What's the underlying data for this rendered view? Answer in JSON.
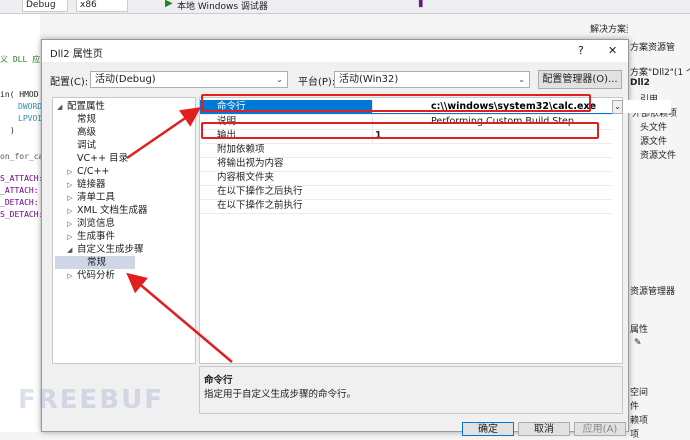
{
  "ide": {
    "config_combo": "Debug",
    "platform_combo": "x86",
    "run_label": "本地 Windows 调试器",
    "solution_explorer_title": "解决方案资源管理器",
    "code_lines": [
      "义 DLL 应",
      "in( HMOD",
      "DWORD",
      "LPVOI",
      ")",
      "on_for_ca",
      "S_ATTACH:",
      "_ATTACH:",
      "_DETACH:",
      "S_DETACH:"
    ],
    "right_items": [
      "方案资源管",
      "方案\"Dll2\"(1 个",
      "Dll2",
      "引用",
      "外部依赖项",
      "头文件",
      "源文件",
      "资源文件",
      "资源管理器",
      "属性",
      "空间",
      "件",
      "赖项",
      "项"
    ]
  },
  "dialog": {
    "title": "Dll2 属性页",
    "help_label": "?",
    "close_label": "✕",
    "config_label": "配置(C):",
    "config_value": "活动(Debug)",
    "platform_label": "平台(P):",
    "platform_value": "活动(Win32)",
    "config_manager_label": "配置管理器(O)...",
    "tree": [
      {
        "label": "配置属性",
        "twisty": "◢",
        "indent": 0
      },
      {
        "label": "常规",
        "twisty": "",
        "indent": 1
      },
      {
        "label": "高级",
        "twisty": "",
        "indent": 1
      },
      {
        "label": "调试",
        "twisty": "",
        "indent": 1
      },
      {
        "label": "VC++ 目录",
        "twisty": "",
        "indent": 1
      },
      {
        "label": "C/C++",
        "twisty": "▷",
        "indent": 1
      },
      {
        "label": "链接器",
        "twisty": "▷",
        "indent": 1
      },
      {
        "label": "清单工具",
        "twisty": "▷",
        "indent": 1
      },
      {
        "label": "XML 文档生成器",
        "twisty": "▷",
        "indent": 1
      },
      {
        "label": "浏览信息",
        "twisty": "▷",
        "indent": 1
      },
      {
        "label": "生成事件",
        "twisty": "▷",
        "indent": 1
      },
      {
        "label": "自定义生成步骤",
        "twisty": "◢",
        "indent": 1
      },
      {
        "label": "常规",
        "twisty": "",
        "indent": 2,
        "selected": true
      },
      {
        "label": "代码分析",
        "twisty": "▷",
        "indent": 1
      }
    ],
    "properties": [
      {
        "name": "命令行",
        "value": "c:\\\\windows\\system32\\calc.exe",
        "selected": true
      },
      {
        "name": "说明",
        "value": "Performing Custom Build Step"
      },
      {
        "name": "输出",
        "value": "1"
      },
      {
        "name": "附加依赖项",
        "value": ""
      },
      {
        "name": "将输出视为内容",
        "value": ""
      },
      {
        "name": "内容根文件夹",
        "value": ""
      },
      {
        "name": "在以下操作之后执行",
        "value": ""
      },
      {
        "name": "在以下操作之前执行",
        "value": ""
      }
    ],
    "description_title": "命令行",
    "description_text": "指定用于自定义生成步骤的命令行。",
    "ok_label": "确定",
    "cancel_label": "取消",
    "apply_label": "应用(A)"
  },
  "annotation_color": "#e02020",
  "watermark": "FREEBUF"
}
